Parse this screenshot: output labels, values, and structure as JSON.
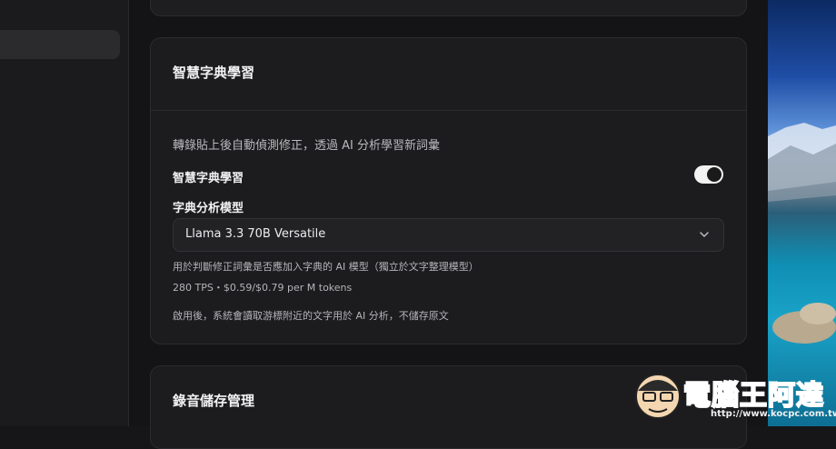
{
  "top_card": {},
  "section": {
    "title": "智慧字典學習",
    "description": "轉錄貼上後自動偵測修正，透過 AI 分析學習新詞彙",
    "toggle": {
      "label": "智慧字典學習",
      "state": "on"
    },
    "model": {
      "label": "字典分析模型",
      "selected": "Llama 3.3 70B Versatile",
      "help": "用於判斷修正詞彙是否應加入字典的 AI 模型（獨立於文字整理模型）",
      "pricing": "280 TPS・$0.59/$0.79 per M tokens"
    },
    "privacy_note": "啟用後，系統會讀取游標附近的文字用於 AI 分析，不儲存原文"
  },
  "section2": {
    "title": "錄音儲存管理"
  },
  "watermark": {
    "text": "電腦王阿達",
    "url": "http://www.kocpc.com.tw"
  },
  "colors": {
    "background": "#141416",
    "card": "#1c1c1e",
    "toggle_on": "#f2f2f2"
  }
}
